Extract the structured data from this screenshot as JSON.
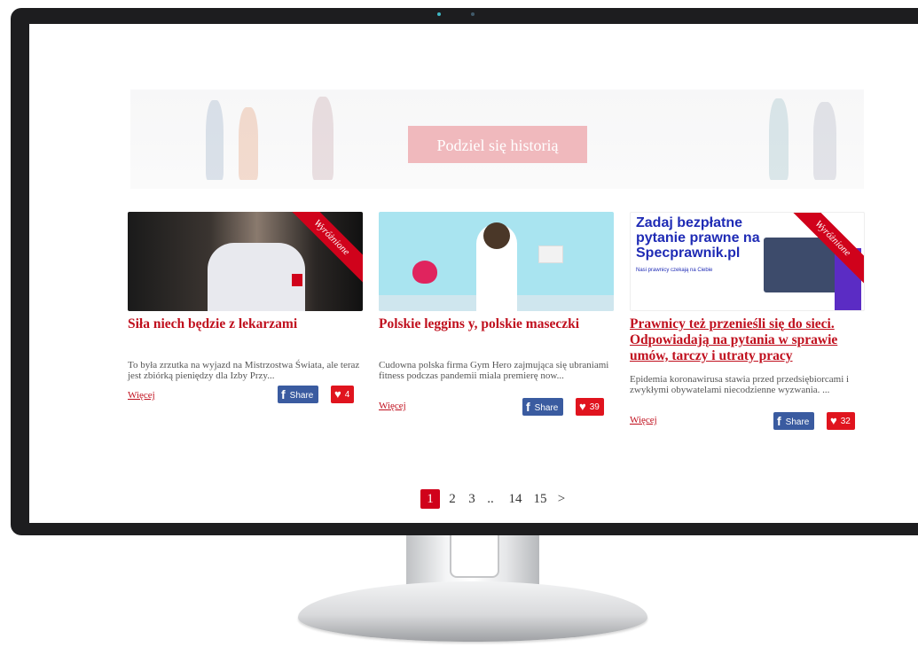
{
  "banner": {
    "button_label": "Podziel się historią"
  },
  "cards": [
    {
      "title": "Siła niech będzie z lekarzami",
      "ribbon": "Wyróżnione",
      "excerpt": "To była zrzutka na wyjazd na Mistrzostwa Świata, ale teraz jest zbiórką pieniędzy dla Izby Przy...",
      "more": "Więcej",
      "share": "Share",
      "likes": "4"
    },
    {
      "title": "Polskie leggins y, polskie maseczki",
      "excerpt": "Cudowna polska firma Gym Hero zajmująca się ubraniami fitness podczas pandemii miala premierę now...",
      "more": "Więcej",
      "share": "Share",
      "likes": "39"
    },
    {
      "title": "Prawnicy też przenieśli się do sieci. Odpowiadają na pytania w sprawie umów, tarczy i utraty pracy",
      "ribbon": "Wyróżnione",
      "ad_headline": "Zadaj bezpłatne pytanie prawne na Specprawnik.pl",
      "ad_sub": "Nasi prawnicy czekają na Ciebie",
      "excerpt": "Epidemia koronawirusa stawia przed przedsiębiorcami i zwykłymi obywatelami niecodzienne wyzwania. ...",
      "more": "Więcej",
      "share": "Share",
      "likes": "32"
    }
  ],
  "pagination": {
    "pages": [
      "1",
      "2",
      "3",
      "..",
      "14",
      "15"
    ],
    "next": ">",
    "current": "1"
  },
  "colors": {
    "accent": "#d0021b",
    "facebook": "#3a5ba0",
    "bezel": "#1d1d1f"
  },
  "icons": [
    "facebook-icon",
    "heart-icon"
  ]
}
